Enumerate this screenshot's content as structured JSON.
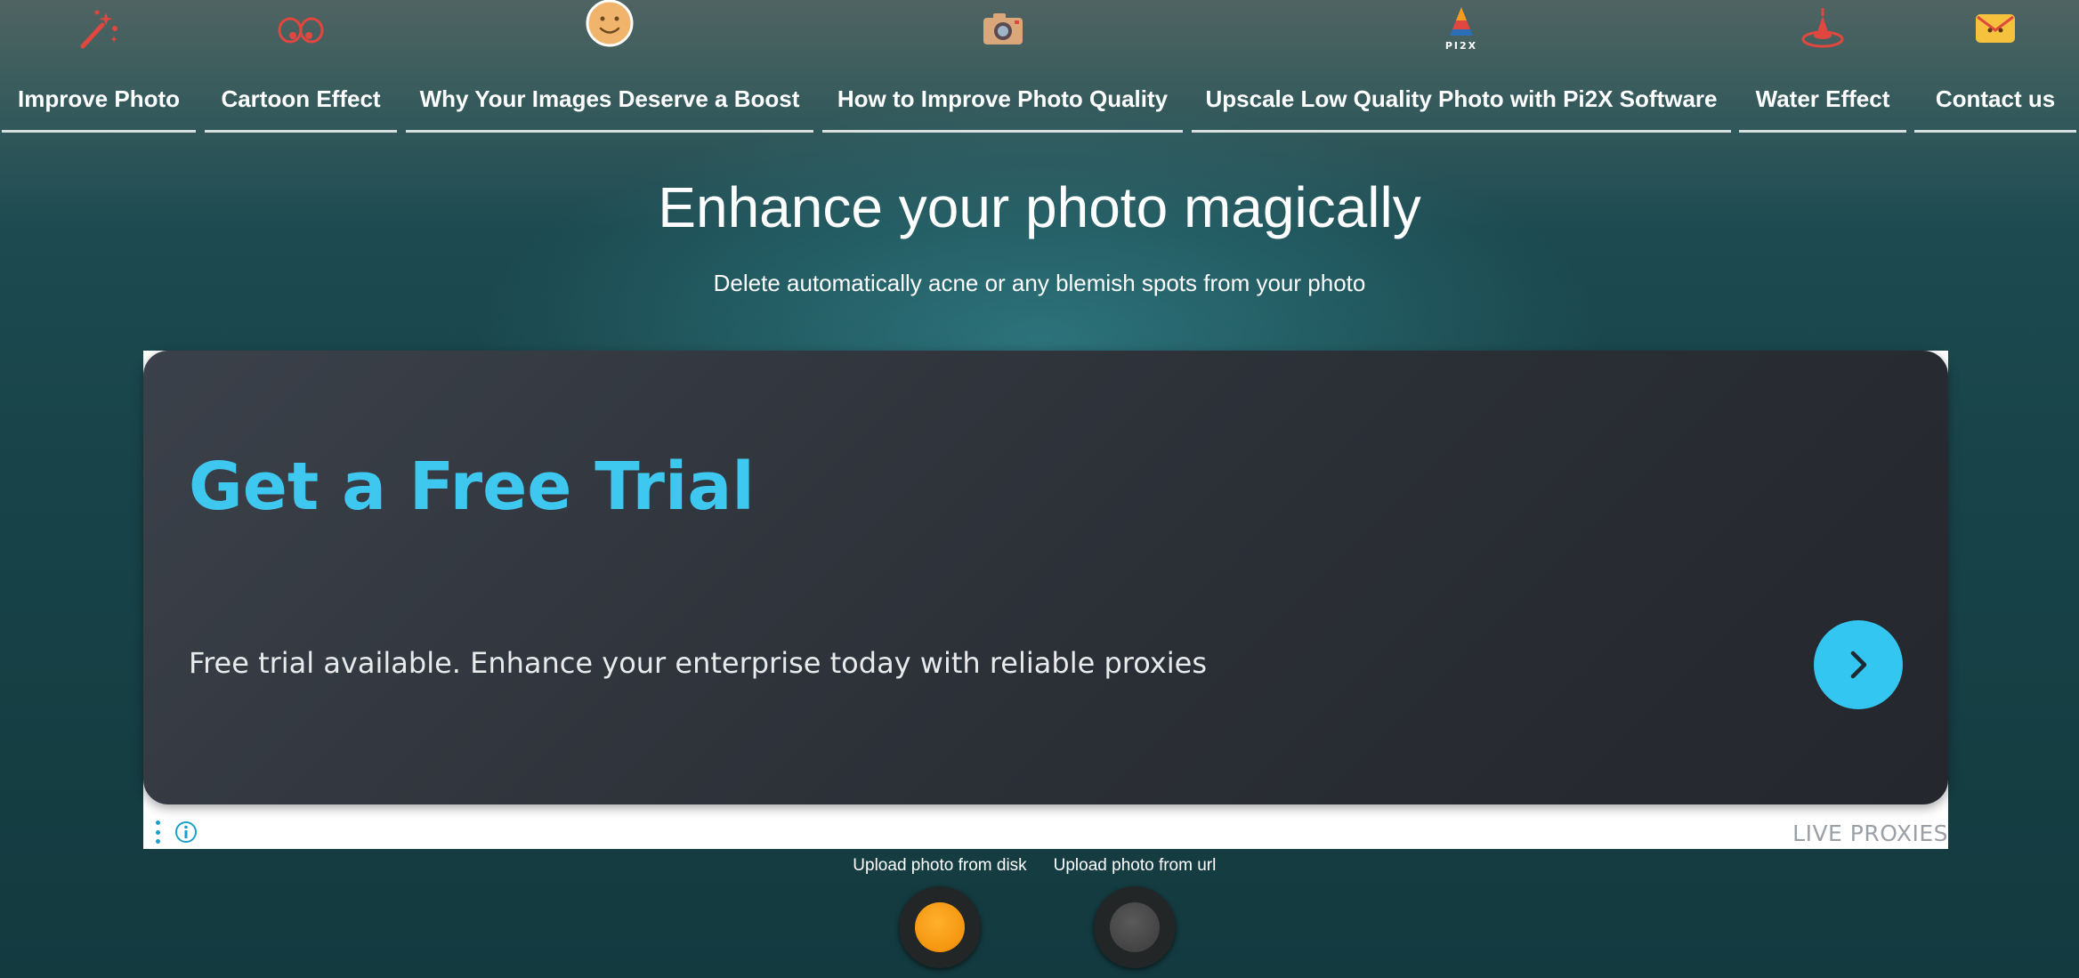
{
  "nav": {
    "items": [
      {
        "label": "Improve Photo",
        "icon": "magic-wand-icon"
      },
      {
        "label": "Cartoon Effect",
        "icon": "cartoon-eyes-icon"
      },
      {
        "label": "Why Your Images Deserve a Boost",
        "icon": "smiley-face-icon"
      },
      {
        "label": "How to Improve Photo Quality",
        "icon": "camera-icon"
      },
      {
        "label": "Upscale Low Quality Photo with Pi2X Software",
        "icon": "pi2x-logo-icon"
      },
      {
        "label": "Water Effect",
        "icon": "water-drop-icon"
      },
      {
        "label": "Contact us",
        "icon": "envelope-icon"
      }
    ],
    "pi2x_logo_text": "PI2X"
  },
  "hero": {
    "title": "Enhance your photo magically",
    "subtitle": "Delete automatically acne or any blemish spots from your photo"
  },
  "ad": {
    "headline": "Get a Free Trial",
    "text": "Free trial available. Enhance your enterprise today with reliable proxies",
    "brand": "LIVE PROXIES",
    "colors": {
      "accent": "#3fc8ef",
      "card": "#2b2f36"
    }
  },
  "upload": {
    "disk_label": "Upload photo from disk",
    "url_label": "Upload photo from url",
    "disk_color": "#ff9f1a",
    "url_color": "#4a4a4a"
  }
}
